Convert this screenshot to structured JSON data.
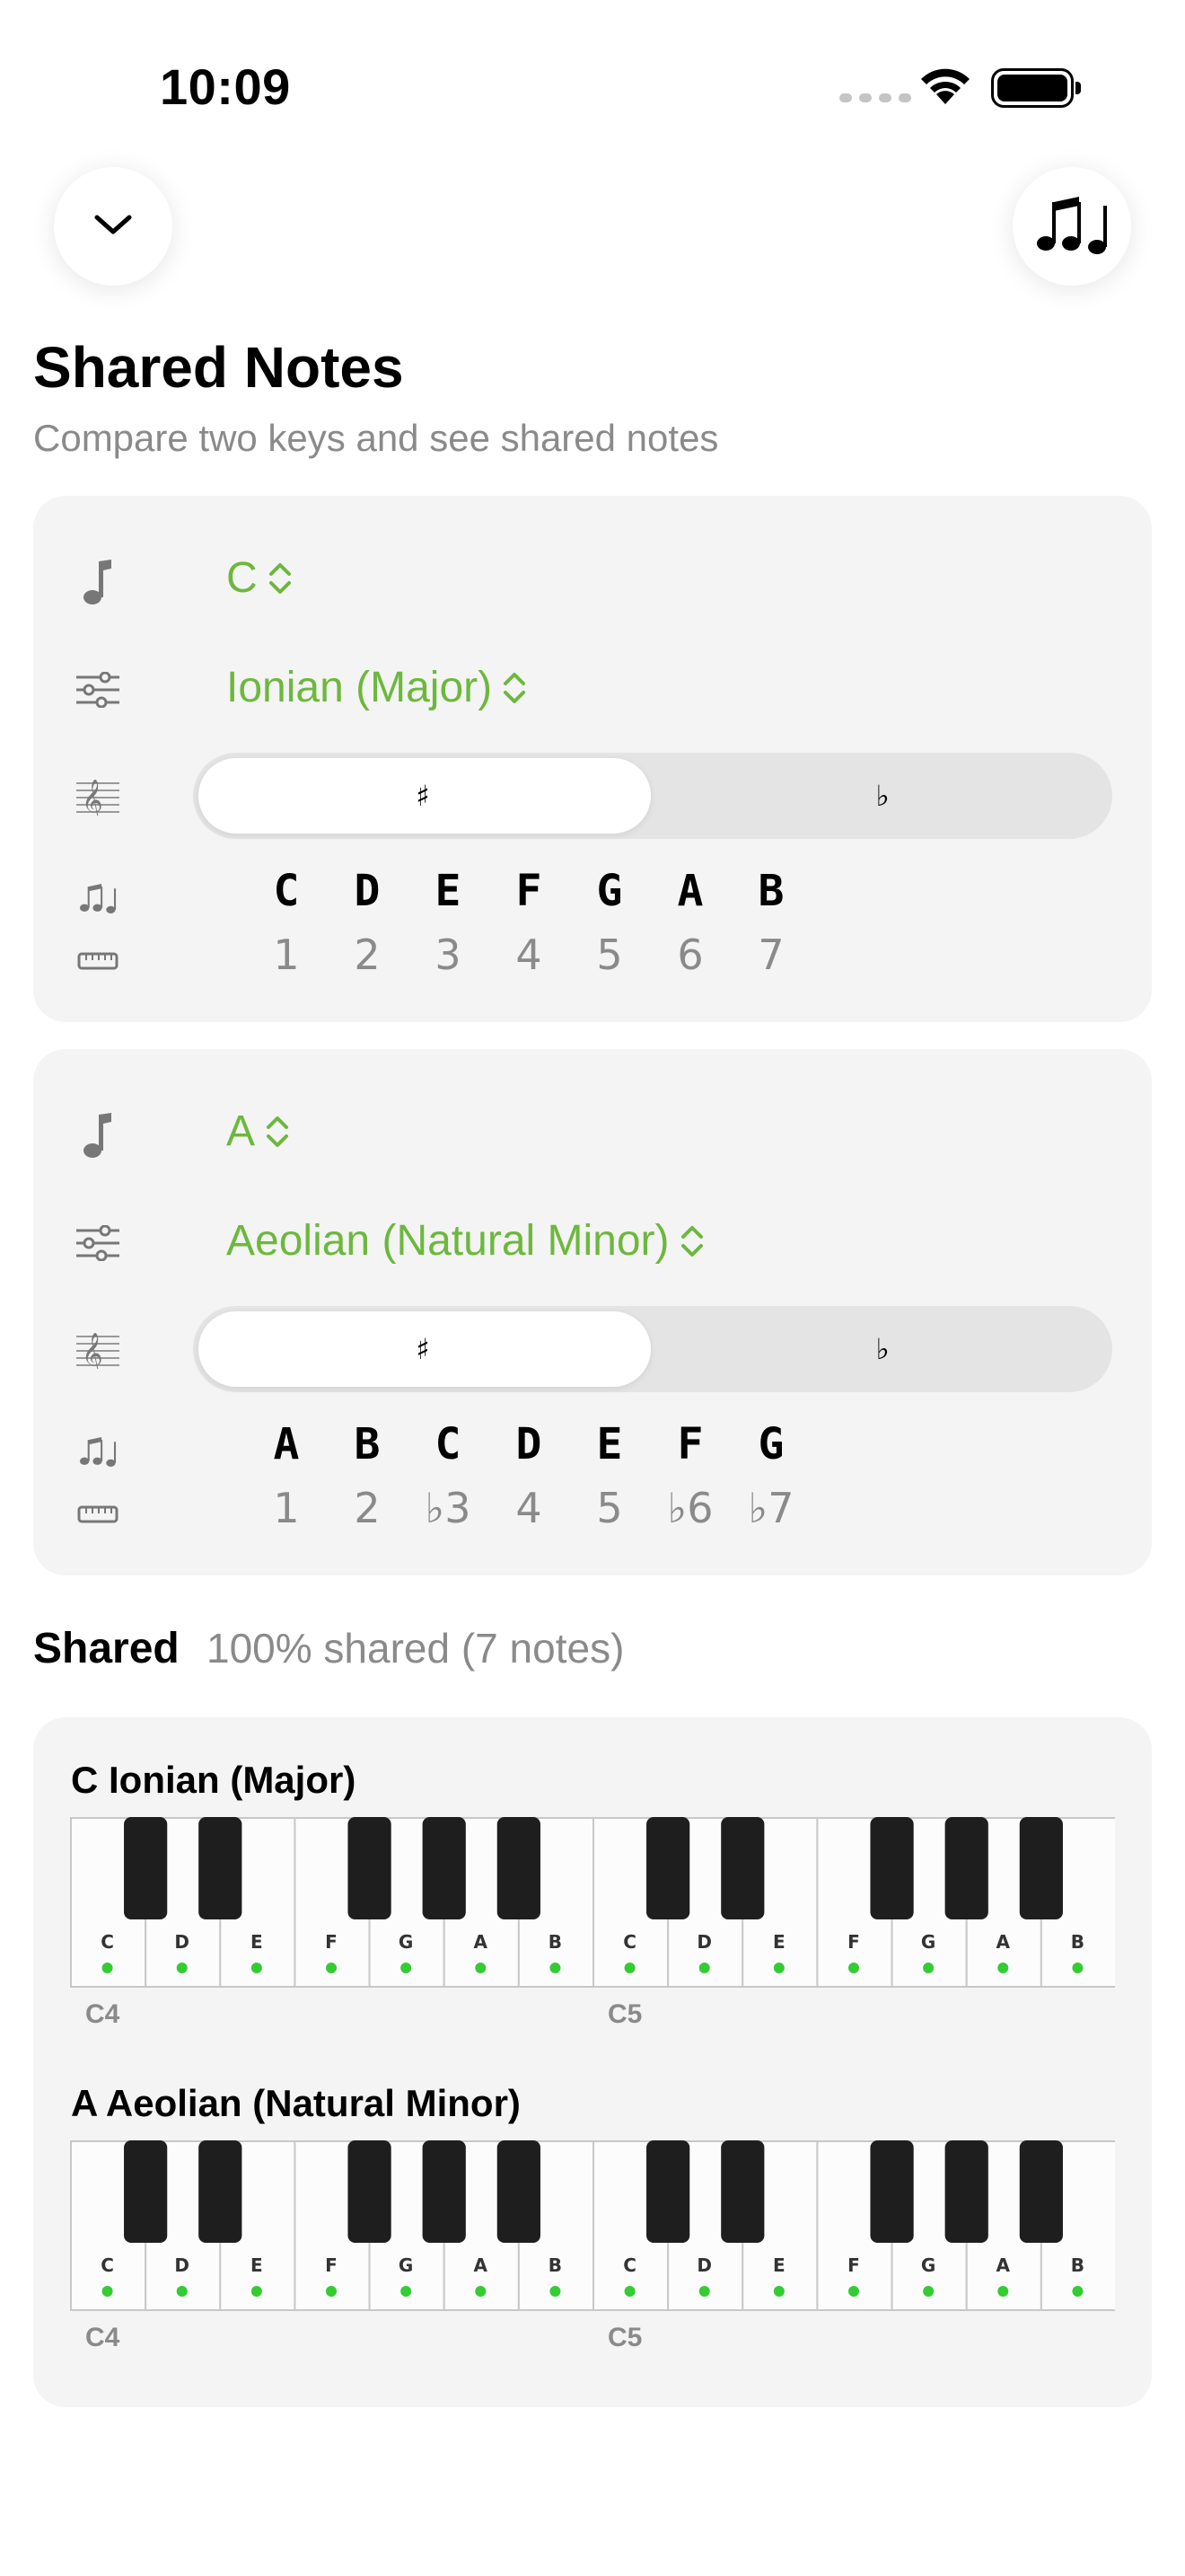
{
  "status": {
    "time": "10:09"
  },
  "header": {
    "title": "Shared Notes",
    "subtitle": "Compare two keys and see shared notes"
  },
  "colors": {
    "accent": "#6cb83d",
    "shared_dot": "#33cc33",
    "card_bg": "#f4f4f4"
  },
  "icons": {
    "back": "chevron-down-icon",
    "notes": "music-notes-icon",
    "key": "music-note-icon",
    "mode": "sliders-icon",
    "accidentals": "treble-clef-icon",
    "notes_row": "music-notes-icon",
    "degrees_row": "ruler-icon"
  },
  "key1": {
    "root": "C",
    "mode": "Ionian (Major)",
    "seg_sharp": "♯",
    "seg_flat": "♭",
    "selected": "sharp",
    "notes": [
      "C",
      "D",
      "E",
      "F",
      "G",
      "A",
      "B"
    ],
    "degrees": [
      "1",
      "2",
      "3",
      "4",
      "5",
      "6",
      "7"
    ]
  },
  "key2": {
    "root": "A",
    "mode": "Aeolian (Natural Minor)",
    "seg_sharp": "♯",
    "seg_flat": "♭",
    "selected": "sharp",
    "notes": [
      "A",
      "B",
      "C",
      "D",
      "E",
      "F",
      "G"
    ],
    "degrees": [
      "1",
      "2",
      "♭3",
      "4",
      "5",
      "♭6",
      "♭7"
    ]
  },
  "shared": {
    "label": "Shared",
    "info": "100% shared (7 notes)"
  },
  "keyboards": [
    {
      "title": "C Ionian (Major)",
      "white_keys": [
        "C",
        "D",
        "E",
        "F",
        "G",
        "A",
        "B",
        "C",
        "D",
        "E",
        "F",
        "G",
        "A",
        "B"
      ],
      "highlighted": [
        true,
        true,
        true,
        true,
        true,
        true,
        true,
        true,
        true,
        true,
        true,
        true,
        true,
        true
      ],
      "octave_labels": [
        "C4",
        "C5"
      ]
    },
    {
      "title": "A Aeolian (Natural Minor)",
      "white_keys": [
        "C",
        "D",
        "E",
        "F",
        "G",
        "A",
        "B",
        "C",
        "D",
        "E",
        "F",
        "G",
        "A",
        "B"
      ],
      "highlighted": [
        true,
        true,
        true,
        true,
        true,
        true,
        true,
        true,
        true,
        true,
        true,
        true,
        true,
        true
      ],
      "octave_labels": [
        "C4",
        "C5"
      ]
    }
  ]
}
